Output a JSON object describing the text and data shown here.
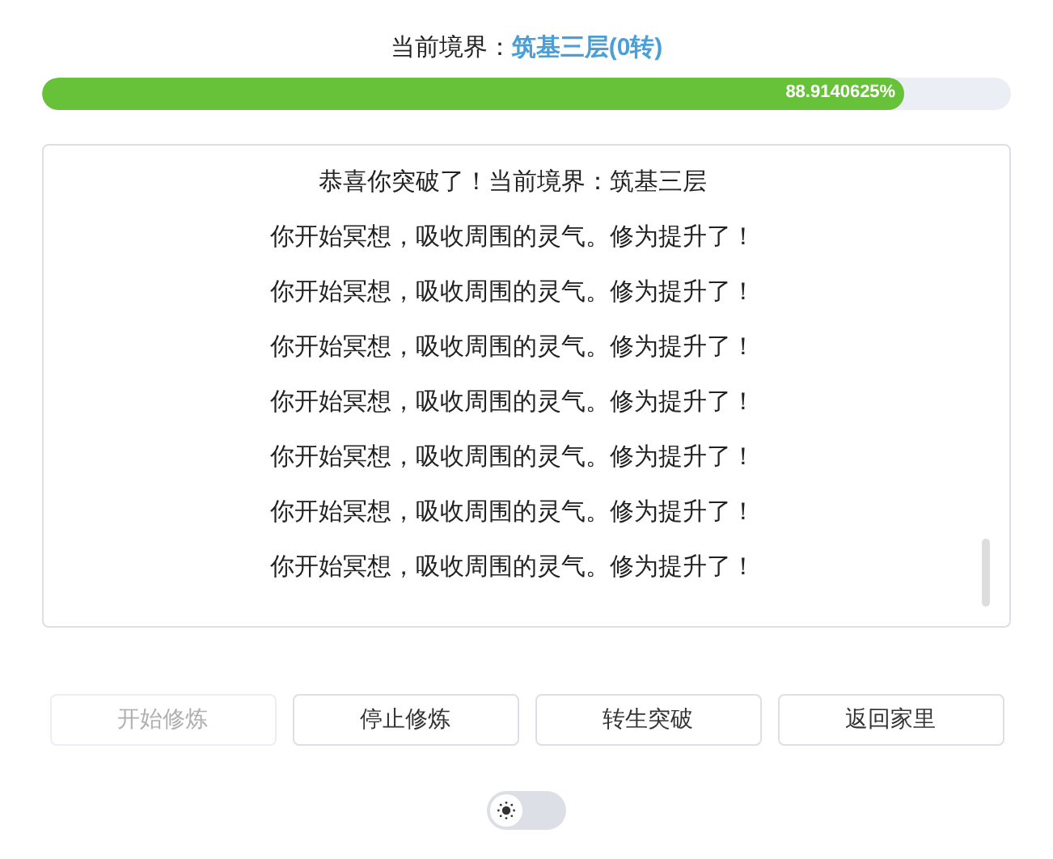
{
  "realm": {
    "label": "当前境界：",
    "value": "筑基三层(0转)"
  },
  "progress": {
    "level": 0.889140625,
    "reading": "88.9140625%"
  },
  "log": [
    "恭喜你突破了！当前境界：筑基三层",
    "你开始冥想，吸收周围的灵气。修为提升了！",
    "你开始冥想，吸收周围的灵气。修为提升了！",
    "你开始冥想，吸收周围的灵气。修为提升了！",
    "你开始冥想，吸收周围的灵气。修为提升了！",
    "你开始冥想，吸收周围的灵气。修为提升了！",
    "你开始冥想，吸收周围的灵气。修为提升了！",
    "你开始冥想，吸收周围的灵气。修为提升了！"
  ],
  "buttons": [
    {
      "label": "开始修炼",
      "disabled": true
    },
    {
      "label": "停止修炼",
      "disabled": false
    },
    {
      "label": "转生突破",
      "disabled": false
    },
    {
      "label": "返回家里",
      "disabled": false
    }
  ],
  "theme_switch": {
    "on": false
  }
}
